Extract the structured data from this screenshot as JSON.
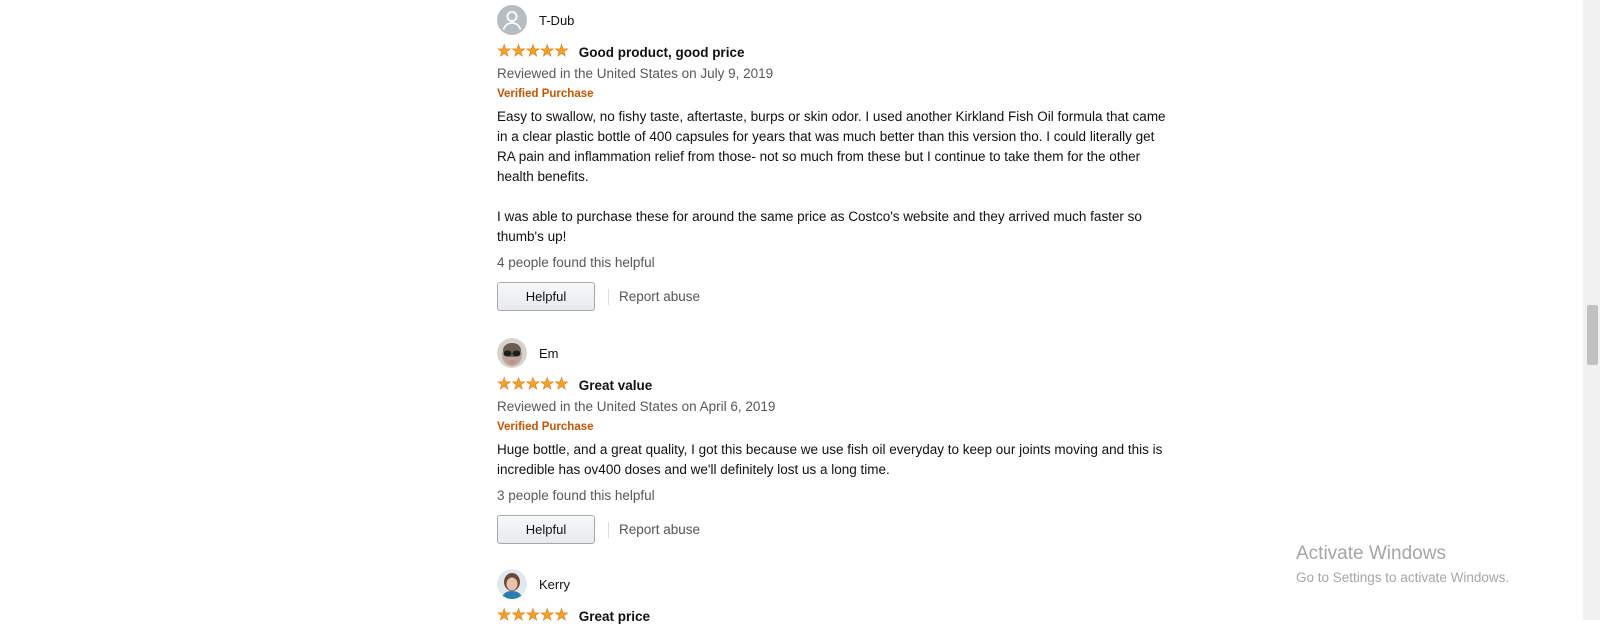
{
  "reviews": [
    {
      "profile_name": "T-Dub",
      "avatar_icon": "default-user-avatar-icon",
      "rating": 5,
      "title": "Good product, good price",
      "date": "Reviewed in the United States on July 9, 2019",
      "verified": "Verified Purchase",
      "body": [
        "Easy to swallow, no fishy taste, aftertaste, burps or skin odor. I used another Kirkland Fish Oil formula that came in a clear plastic bottle of 400 capsules for years that was much better than this version tho. I could literally get RA pain and inflammation relief from those- not so much from these but I continue to take them for the other health benefits.",
        "I was able to purchase these for around the same price as Costco's website and they arrived much faster so thumb's up!"
      ],
      "helpful_count": "4 people found this helpful",
      "helpful_button": "Helpful",
      "report_abuse": "Report abuse"
    },
    {
      "profile_name": "Em",
      "avatar_icon": "profile-photo-avatar",
      "rating": 5,
      "title": "Great value",
      "date": "Reviewed in the United States on April 6, 2019",
      "verified": "Verified Purchase",
      "body": [
        "Huge bottle, and a great quality, I got this because we use fish oil everyday to keep our joints moving and this is incredible has ov400 doses and we'll definitely lost us a long time."
      ],
      "helpful_count": "3 people found this helpful",
      "helpful_button": "Helpful",
      "report_abuse": "Report abuse"
    },
    {
      "profile_name": "Kerry",
      "avatar_icon": "profile-photo-avatar",
      "rating": 5,
      "title": "Great price"
    }
  ],
  "stars": {
    "glyph": "★",
    "color": "#f7a21b"
  },
  "colors": {
    "verified": "#c45500",
    "muted": "#565959"
  },
  "watermark": {
    "title": "Activate Windows",
    "subtitle": "Go to Settings to activate Windows."
  }
}
